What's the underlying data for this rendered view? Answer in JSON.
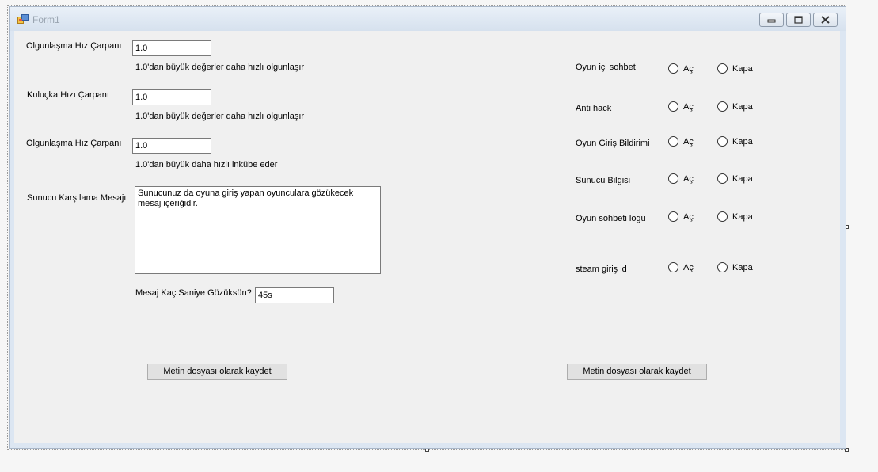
{
  "window": {
    "title": "Form1"
  },
  "left": {
    "fields": [
      {
        "label": "Olgunlaşma Hız Çarpanı",
        "value": "1.0",
        "hint": "1.0'dan büyük değerler daha hızlı olgunlaşır"
      },
      {
        "label": "Kuluçka Hızı Çarpanı",
        "value": "1.0",
        "hint": "1.0'dan büyük değerler daha hızlı olgunlaşır"
      },
      {
        "label": "Olgunlaşma Hız Çarpanı",
        "value": "1.0",
        "hint": "1.0'dan büyük daha hızlı inkübe eder"
      }
    ],
    "welcome": {
      "label": "Sunucu Karşılama Mesajı",
      "value": "Sunucunuz da oyuna giriş yapan oyunculara gözükecek mesaj içeriğidir."
    },
    "duration": {
      "label": "Mesaj Kaç Saniye Gözüksün?",
      "value": "45s"
    },
    "save_label": "Metin dosyası olarak kaydet"
  },
  "right": {
    "on_label": "Aç",
    "off_label": "Kapa",
    "options": [
      {
        "label": "Oyun içi sohbet"
      },
      {
        "label": "Anti hack"
      },
      {
        "label": "Oyun Giriş Bildirimi"
      },
      {
        "label": "Sunucu Bilgisi"
      },
      {
        "label": "Oyun sohbeti logu"
      },
      {
        "label": "steam giriş id"
      }
    ],
    "save_label": "Metin dosyası olarak kaydet"
  }
}
